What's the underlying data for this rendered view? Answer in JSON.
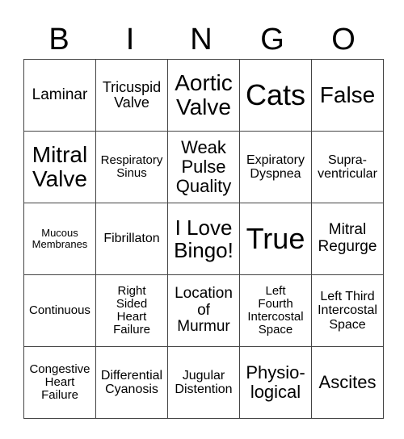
{
  "header": [
    "B",
    "I",
    "N",
    "G",
    "O"
  ],
  "rows": [
    [
      "Laminar",
      "Tricuspid\nValve",
      "Aortic\nValve",
      "Cats",
      "False"
    ],
    [
      "Mitral\nValve",
      "Respiratory\nSinus",
      "Weak\nPulse\nQuality",
      "Expiratory\nDyspnea",
      "Supra-\nventricular"
    ],
    [
      "Mucous\nMembranes",
      "Fibrillaton",
      "I Love\nBingo!",
      "True",
      "Mitral\nRegurge"
    ],
    [
      "Continuous",
      "Right\nSided\nHeart\nFailure",
      "Location\nof\nMurmur",
      "Left\nFourth\nIntercostal\nSpace",
      "Left Third\nIntercostal\nSpace"
    ],
    [
      "Congestive\nHeart\nFailure",
      "Differential\nCyanosis",
      "Jugular\nDistention",
      "Physio-\nlogical",
      "Ascites"
    ]
  ]
}
